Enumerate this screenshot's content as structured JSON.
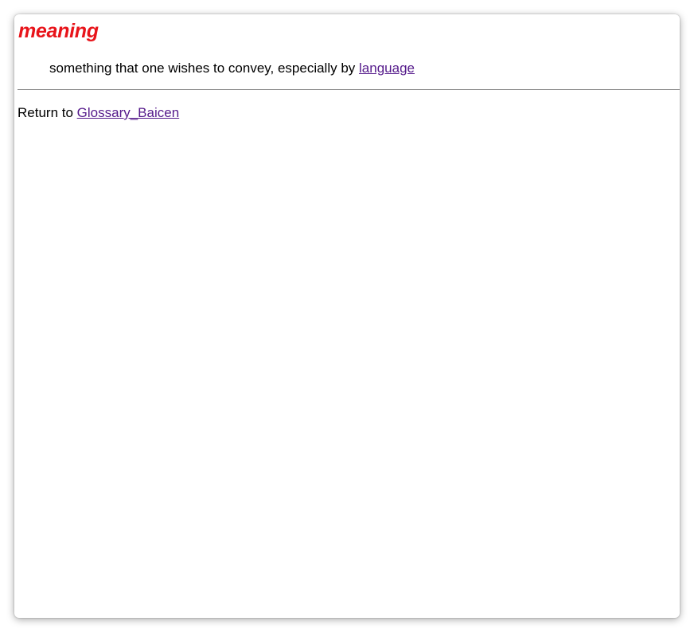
{
  "entry": {
    "term": "meaning",
    "definition_text": "something that one wishes to convey, especially by ",
    "definition_link": "language"
  },
  "footer": {
    "return_text": "Return to ",
    "return_link": "Glossary_Baicen"
  },
  "colors": {
    "term_color": "#e8141a",
    "link_color": "#551a8b",
    "rule_color": "#8a8a8a"
  }
}
